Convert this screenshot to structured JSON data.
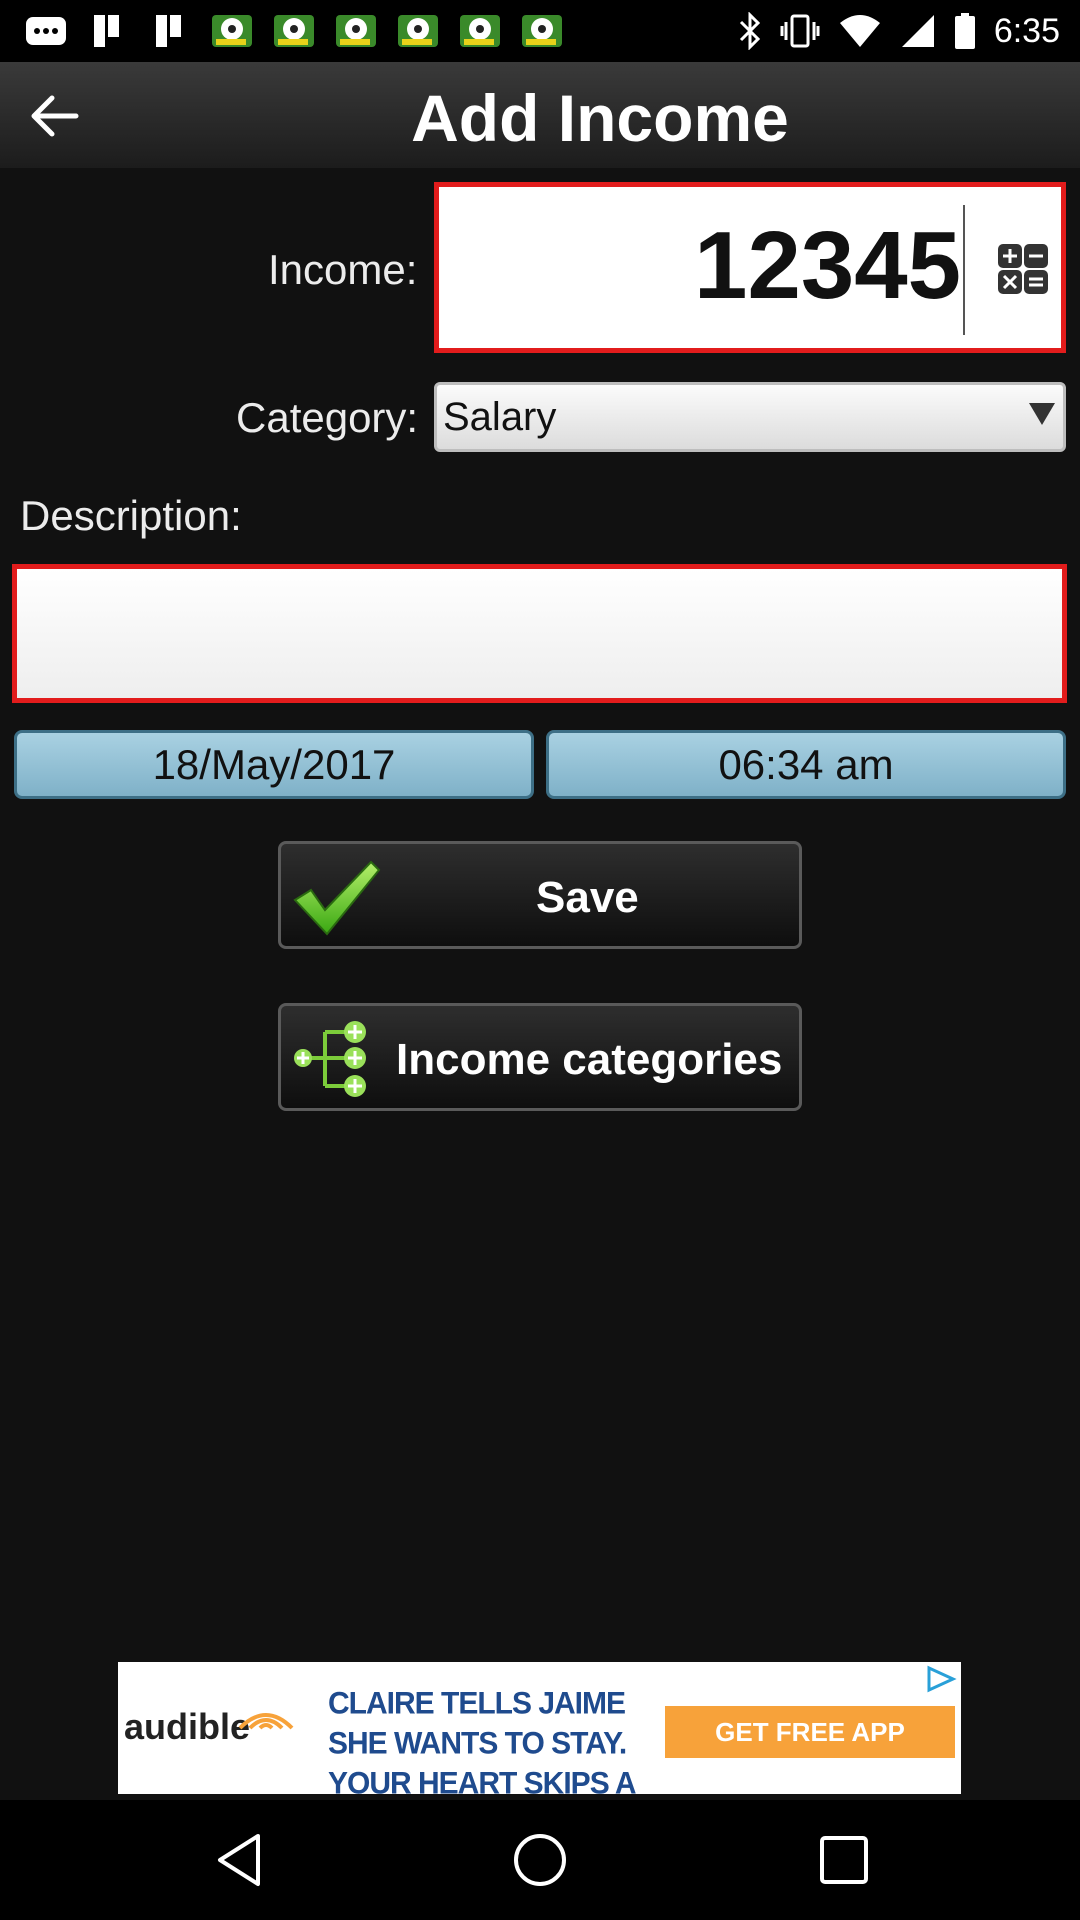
{
  "status_bar": {
    "time": "6:35",
    "notification_icons": [
      "app-icon",
      "bookmark-icon",
      "bookmark-icon",
      "soccer-icon",
      "soccer-icon",
      "soccer-icon",
      "soccer-icon",
      "soccer-icon",
      "soccer-icon"
    ],
    "system_icons": [
      "bluetooth-icon",
      "vibrate-icon",
      "wifi-icon",
      "signal-icon",
      "battery-icon"
    ]
  },
  "header": {
    "title": "Add Income",
    "back_icon": "back-arrow-icon"
  },
  "form": {
    "income_label": "Income:",
    "income_value": "12345",
    "calculator_icon": "calculator-icon",
    "category_label": "Category:",
    "category_value": "Salary",
    "description_label": "Description:",
    "description_value": "",
    "date": "18/May/2017",
    "time": "06:34 am"
  },
  "actions": {
    "save_label": "Save",
    "save_icon": "checkmark-icon",
    "categories_label": "Income categories",
    "categories_icon": "tree-icon"
  },
  "ad": {
    "brand": "audible",
    "text": "CLAIRE TELLS JAIME SHE WANTS TO STAY. YOUR HEART SKIPS A BEAT.",
    "cta": "GET FREE APP"
  },
  "nav_bar": {
    "icons": [
      "back-nav-icon",
      "home-nav-icon",
      "recents-nav-icon"
    ]
  },
  "colors": {
    "accent_red": "#e21c1c",
    "pill_blue": "#8fbfd4",
    "background": "#111111",
    "check_green": "#5fd31c"
  }
}
